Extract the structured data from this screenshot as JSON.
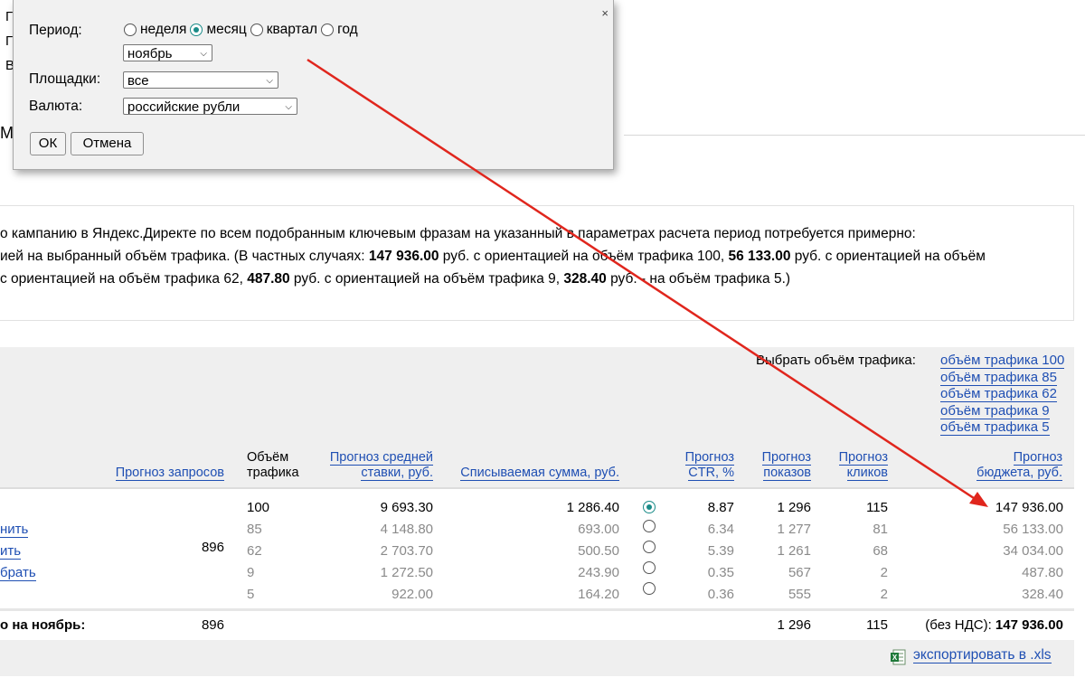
{
  "background": {
    "left_letters": [
      "Г",
      "Г",
      "В"
    ],
    "section_letter": "М",
    "description": {
      "line1": "о кампанию в Яндекс.Директе по всем подобранным ключевым фразам на указанный в параметрах расчета период потребуется примерно:",
      "line2_pre": "ией на выбранный объём трафика. (В частных случаях: ",
      "v100": "147 936.00",
      "line2_mid1": " руб. с ориентацией на объём трафика 100, ",
      "v85": "56 133.00",
      "line2_mid2": " руб. с ориентацией на объём",
      "line3_pre": "с ориентацией на объём трафика 62, ",
      "v9": "487.80",
      "line3_mid": " руб. с ориентацией на объём трафика 9, ",
      "v5": "328.40",
      "line3_end": " руб. - на объём трафика 5.)"
    }
  },
  "traffic_selector": {
    "label": "Выбрать объём трафика:",
    "links": [
      "объём трафика 100",
      "объём трафика 85",
      "объём трафика 62",
      "объём трафика 9",
      "объём трафика 5"
    ]
  },
  "table": {
    "headers": {
      "requests": "Прогноз запросов",
      "traffic_line1": "Объём",
      "traffic_line2": "трафика",
      "bid_line1": "Прогноз средней",
      "bid_line2": "ставки, руб.",
      "charge": "Списываемая сумма, руб.",
      "ctr_line1": "Прогноз",
      "ctr_line2": "CTR, %",
      "shows_line1": "Прогноз",
      "shows_line2": "показов",
      "clicks_line1": "Прогноз",
      "clicks_line2": "кликов",
      "budget_line1": "Прогноз",
      "budget_line2": "бюджета, руб."
    },
    "side_links": [
      "нить",
      "ить",
      "брать"
    ],
    "requests_value": "896",
    "rows": [
      {
        "traffic": "100",
        "bid": "9 693.30",
        "charge": "1 286.40",
        "ctr": "8.87",
        "shows": "1 296",
        "clicks": "115",
        "budget": "147 936.00"
      },
      {
        "traffic": "85",
        "bid": "4 148.80",
        "charge": "693.00",
        "ctr": "6.34",
        "shows": "1 277",
        "clicks": "81",
        "budget": "56 133.00"
      },
      {
        "traffic": "62",
        "bid": "2 703.70",
        "charge": "500.50",
        "ctr": "5.39",
        "shows": "1 261",
        "clicks": "68",
        "budget": "34 034.00"
      },
      {
        "traffic": "9",
        "bid": "1 272.50",
        "charge": "243.90",
        "ctr": "0.35",
        "shows": "567",
        "clicks": "2",
        "budget": "487.80"
      },
      {
        "traffic": "5",
        "bid": "922.00",
        "charge": "164.20",
        "ctr": "0.36",
        "shows": "555",
        "clicks": "2",
        "budget": "328.40"
      }
    ],
    "selected_row": 0,
    "totals": {
      "label": "о на ноябрь:",
      "requests": "896",
      "shows": "1 296",
      "clicks": "115",
      "budget_prefix": "(без НДС):",
      "budget": "147 936.00"
    },
    "export_label": "экспортировать в .xls"
  },
  "dialog": {
    "close": "×",
    "period_label": "Период:",
    "period_options": [
      "неделя",
      "месяц",
      "квартал",
      "год"
    ],
    "period_selected": 1,
    "month_value": "ноябрь",
    "platforms_label": "Площадки:",
    "platforms_value": "все",
    "currency_label": "Валюта:",
    "currency_value": "российские рубли",
    "ok_label": "ОК",
    "cancel_label": "Отмена"
  },
  "colors": {
    "link": "#1f4fb3",
    "radio_selected": "#1a8b88",
    "arrow": "#e0261d",
    "table_bg": "#efefef"
  }
}
